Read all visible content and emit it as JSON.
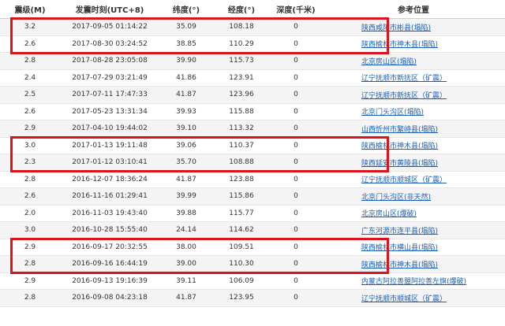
{
  "columns": {
    "magnitude": "震级(M)",
    "time": "发震时刻(UTC+8)",
    "lat": "纬度(°)",
    "lon": "经度(°)",
    "depth": "深度(千米)",
    "location": "参考位置"
  },
  "rows": [
    {
      "magnitude": "3.2",
      "time": "2017-09-05 01:14:22",
      "lat": "35.09",
      "lon": "108.18",
      "depth": "0",
      "location": "陕西咸阳市彬县(塌陷)",
      "highlighted": true
    },
    {
      "magnitude": "2.6",
      "time": "2017-08-30 03:24:52",
      "lat": "38.85",
      "lon": "110.29",
      "depth": "0",
      "location": "陕西榆林市神木县(塌陷)",
      "highlighted": true
    },
    {
      "magnitude": "2.8",
      "time": "2017-08-28 23:05:08",
      "lat": "39.90",
      "lon": "115.73",
      "depth": "0",
      "location": "北京房山区(塌陷)",
      "highlighted": false
    },
    {
      "magnitude": "2.4",
      "time": "2017-07-29 03:21:49",
      "lat": "41.86",
      "lon": "123.91",
      "depth": "0",
      "location": "辽宁抚顺市新抚区（矿震）",
      "highlighted": false
    },
    {
      "magnitude": "2.5",
      "time": "2017-07-11 17:47:33",
      "lat": "41.87",
      "lon": "123.96",
      "depth": "0",
      "location": "辽宁抚顺市新抚区（矿震）",
      "highlighted": false
    },
    {
      "magnitude": "2.6",
      "time": "2017-05-23 13:31:34",
      "lat": "39.93",
      "lon": "115.88",
      "depth": "0",
      "location": "北京门头沟区(塌陷)",
      "highlighted": false
    },
    {
      "magnitude": "2.9",
      "time": "2017-04-10 19:44:02",
      "lat": "39.10",
      "lon": "113.32",
      "depth": "0",
      "location": "山西忻州市繁峙县(塌陷)",
      "highlighted": false
    },
    {
      "magnitude": "3.0",
      "time": "2017-01-13 19:11:48",
      "lat": "39.06",
      "lon": "110.37",
      "depth": "0",
      "location": "陕西榆林市神木县(塌陷)",
      "highlighted": true
    },
    {
      "magnitude": "2.3",
      "time": "2017-01-12 03:10:41",
      "lat": "35.70",
      "lon": "108.88",
      "depth": "0",
      "location": "陕西延安市黄陵县(塌陷)",
      "highlighted": true
    },
    {
      "magnitude": "2.8",
      "time": "2016-12-07 18:36:24",
      "lat": "41.87",
      "lon": "123.88",
      "depth": "0",
      "location": "辽宁抚顺市顺城区（矿震）",
      "highlighted": false
    },
    {
      "magnitude": "2.6",
      "time": "2016-11-16 01:29:41",
      "lat": "39.99",
      "lon": "115.86",
      "depth": "0",
      "location": "北京门头沟区(非天然)",
      "highlighted": false
    },
    {
      "magnitude": "2.0",
      "time": "2016-11-03 19:43:40",
      "lat": "39.88",
      "lon": "115.77",
      "depth": "0",
      "location": "北京房山区(爆破)",
      "highlighted": false
    },
    {
      "magnitude": "3.0",
      "time": "2016-10-28 15:55:40",
      "lat": "24.14",
      "lon": "114.62",
      "depth": "0",
      "location": "广东河源市连平县(塌陷)",
      "highlighted": false
    },
    {
      "magnitude": "2.9",
      "time": "2016-09-17 20:32:55",
      "lat": "38.00",
      "lon": "109.51",
      "depth": "0",
      "location": "陕西榆林市横山县(塌陷)",
      "highlighted": true
    },
    {
      "magnitude": "2.8",
      "time": "2016-09-16 16:44:19",
      "lat": "39.00",
      "lon": "110.30",
      "depth": "0",
      "location": "陕西榆林市神木县(塌陷)",
      "highlighted": true
    },
    {
      "magnitude": "2.9",
      "time": "2016-09-13 19:16:39",
      "lat": "39.11",
      "lon": "106.09",
      "depth": "0",
      "location": "内蒙古阿拉善盟阿拉善左旗(爆破)",
      "highlighted": false
    },
    {
      "magnitude": "2.8",
      "time": "2016-09-08 04:23:18",
      "lat": "41.87",
      "lon": "123.95",
      "depth": "0",
      "location": "辽宁抚顺市顺城区（矿震）",
      "highlighted": false
    }
  ],
  "colors": {
    "highlight_border": "#d9141c",
    "link": "#1a5fb4",
    "row_alt": "#f4f4f4"
  }
}
